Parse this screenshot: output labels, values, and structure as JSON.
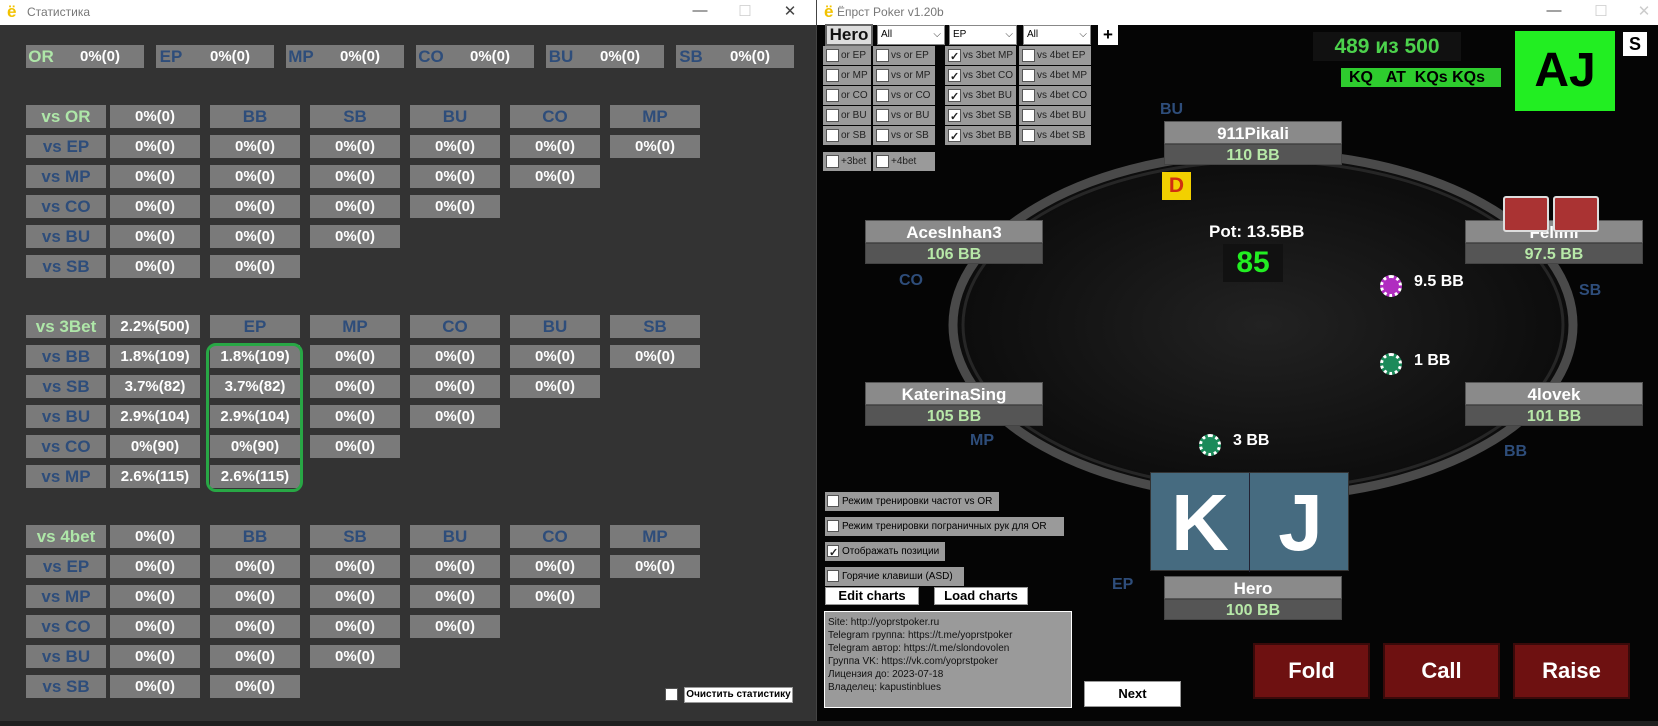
{
  "stats": {
    "title": "Статистика",
    "top": [
      {
        "label": "OR",
        "value": "0%(0)"
      },
      {
        "label": "EP",
        "value": "0%(0)"
      },
      {
        "label": "MP",
        "value": "0%(0)"
      },
      {
        "label": "CO",
        "value": "0%(0)"
      },
      {
        "label": "BU",
        "value": "0%(0)"
      },
      {
        "label": "SB",
        "value": "0%(0)"
      }
    ],
    "vsor": {
      "label": "vs OR",
      "total": "0%(0)",
      "headers": [
        "BB",
        "SB",
        "BU",
        "CO",
        "MP"
      ],
      "rows": [
        {
          "label": "vs EP",
          "total": "0%(0)",
          "cells": [
            "0%(0)",
            "0%(0)",
            "0%(0)",
            "0%(0)",
            "0%(0)"
          ]
        },
        {
          "label": "vs MP",
          "total": "0%(0)",
          "cells": [
            "0%(0)",
            "0%(0)",
            "0%(0)",
            "0%(0)"
          ]
        },
        {
          "label": "vs CO",
          "total": "0%(0)",
          "cells": [
            "0%(0)",
            "0%(0)",
            "0%(0)"
          ]
        },
        {
          "label": "vs BU",
          "total": "0%(0)",
          "cells": [
            "0%(0)",
            "0%(0)"
          ]
        },
        {
          "label": "vs SB",
          "total": "0%(0)",
          "cells": [
            "0%(0)"
          ]
        }
      ]
    },
    "vs3bet": {
      "label": "vs 3Bet",
      "total": "2.2%(500)",
      "headers": [
        "EP",
        "MP",
        "CO",
        "BU",
        "SB"
      ],
      "rows": [
        {
          "label": "vs BB",
          "total": "1.8%(109)",
          "cells": [
            "1.8%(109)",
            "0%(0)",
            "0%(0)",
            "0%(0)",
            "0%(0)"
          ]
        },
        {
          "label": "vs SB",
          "total": "3.7%(82)",
          "cells": [
            "3.7%(82)",
            "0%(0)",
            "0%(0)",
            "0%(0)"
          ]
        },
        {
          "label": "vs BU",
          "total": "2.9%(104)",
          "cells": [
            "2.9%(104)",
            "0%(0)",
            "0%(0)"
          ]
        },
        {
          "label": "vs CO",
          "total": "0%(90)",
          "cells": [
            "0%(90)",
            "0%(0)"
          ]
        },
        {
          "label": "vs MP",
          "total": "2.6%(115)",
          "cells": [
            "2.6%(115)"
          ]
        }
      ]
    },
    "vs4bet": {
      "label": "vs 4bet",
      "total": "0%(0)",
      "headers": [
        "BB",
        "SB",
        "BU",
        "CO",
        "MP"
      ],
      "rows": [
        {
          "label": "vs EP",
          "total": "0%(0)",
          "cells": [
            "0%(0)",
            "0%(0)",
            "0%(0)",
            "0%(0)",
            "0%(0)"
          ]
        },
        {
          "label": "vs MP",
          "total": "0%(0)",
          "cells": [
            "0%(0)",
            "0%(0)",
            "0%(0)",
            "0%(0)"
          ]
        },
        {
          "label": "vs CO",
          "total": "0%(0)",
          "cells": [
            "0%(0)",
            "0%(0)",
            "0%(0)"
          ]
        },
        {
          "label": "vs BU",
          "total": "0%(0)",
          "cells": [
            "0%(0)",
            "0%(0)"
          ]
        },
        {
          "label": "vs SB",
          "total": "0%(0)",
          "cells": [
            "0%(0)"
          ]
        }
      ]
    },
    "clear_label": "Очистить статистику"
  },
  "game": {
    "title": "Ёпрст Poker v1.20b",
    "hero_tab": "Hero",
    "selects": [
      "All",
      "EP",
      "All"
    ],
    "plus": "+",
    "col1": [
      {
        "l": "or EP",
        "c": false
      },
      {
        "l": "or MP",
        "c": false
      },
      {
        "l": "or CO",
        "c": false
      },
      {
        "l": "or BU",
        "c": false
      },
      {
        "l": "or SB",
        "c": false
      }
    ],
    "col2": [
      {
        "l": "vs or EP",
        "c": false
      },
      {
        "l": "vs or MP",
        "c": false
      },
      {
        "l": "vs or CO",
        "c": false
      },
      {
        "l": "vs or BU",
        "c": false
      },
      {
        "l": "vs or SB",
        "c": false
      }
    ],
    "col3": [
      {
        "l": "vs 3bet MP",
        "c": true
      },
      {
        "l": "vs 3bet CO",
        "c": true
      },
      {
        "l": "vs 3bet BU",
        "c": true
      },
      {
        "l": "vs 3bet SB",
        "c": true
      },
      {
        "l": "vs 3bet BB",
        "c": true
      }
    ],
    "col4": [
      {
        "l": "vs 4bet EP",
        "c": false
      },
      {
        "l": "vs 4bet MP",
        "c": false
      },
      {
        "l": "vs 4bet CO",
        "c": false
      },
      {
        "l": "vs 4bet BU",
        "c": false
      },
      {
        "l": "vs 4bet SB",
        "c": false
      }
    ],
    "plus3bet": "+3bet",
    "plus4bet": "+4bet",
    "score": "489 из 500",
    "recent": "KQ   AT  KQs KQs",
    "last_hand": "AJ",
    "s_label": "S",
    "pot": "Pot: 13.5BB",
    "timer": "85",
    "dealer": "D",
    "seats": [
      {
        "name": "911Pikali",
        "stack": "110 BB",
        "pos": "BU"
      },
      {
        "name": "AcesInhan3",
        "stack": "106 BB",
        "pos": "CO"
      },
      {
        "name": "Fellini",
        "stack": "97.5 BB",
        "pos": "SB"
      },
      {
        "name": "KaterinaSing",
        "stack": "105 BB",
        "pos": "MP"
      },
      {
        "name": "4lovek",
        "stack": "101 BB",
        "pos": "BB"
      },
      {
        "name": "Hero",
        "stack": "100 BB",
        "pos": "EP"
      }
    ],
    "bets": [
      "9.5 BB",
      "1 BB",
      "3 BB"
    ],
    "hero_cards": [
      "K",
      "J"
    ],
    "options": [
      {
        "l": "Режим тренировки частот vs OR",
        "c": false
      },
      {
        "l": "Режим тренировки пограничных рук для OR",
        "c": false
      },
      {
        "l": "Отображать позиции",
        "c": true
      },
      {
        "l": "Горячие клавиши (ASD)",
        "c": false
      }
    ],
    "edit_charts": "Edit charts",
    "load_charts": "Load charts",
    "info": [
      "Site: http://yoprstpoker.ru",
      "Telegram группа: https://t.me/yoprstpoker",
      "Telegram автор: https://t.me/slondovolen",
      "Группа VK: https://vk.com/yoprstpoker",
      "Лицензия до: 2023-07-18",
      "Владелец: kapustinblues"
    ],
    "next": "Next",
    "fold": "Fold",
    "call": "Call",
    "raise": "Raise"
  }
}
